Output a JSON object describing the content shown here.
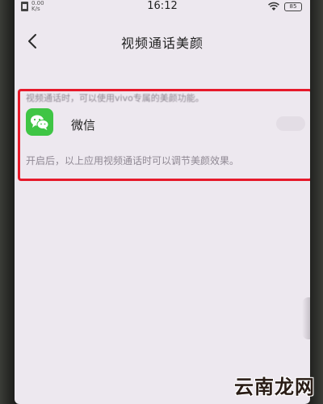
{
  "status_bar": {
    "net_speed_value": "0.00",
    "net_speed_unit": "K/s",
    "time": "16:12",
    "battery": "85"
  },
  "header": {
    "title": "视频通话美颜"
  },
  "content": {
    "description": "视频通话时，可以使用vivo专属的美颜功能。",
    "app_item": {
      "name": "微信",
      "icon": "wechat-icon",
      "toggle_state": "off"
    },
    "note": "开启后，以上应用视频通话时可以调节美颜效果。"
  },
  "annotation": {
    "color": "#e6192a"
  },
  "watermark": {
    "text": "云南龙网"
  }
}
